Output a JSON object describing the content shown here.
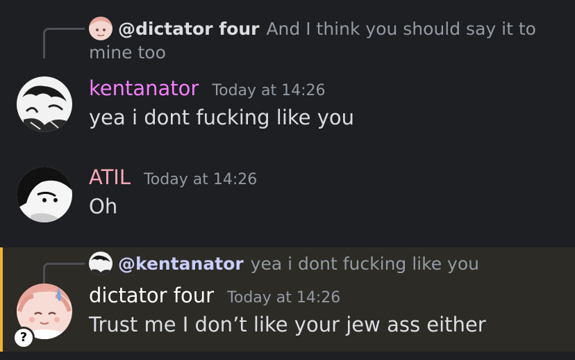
{
  "colors": {
    "background": "#1e1f22",
    "highlight_background": "#2d2b26",
    "highlight_bar": "#f0b232",
    "kentanator_name": "#f47fff",
    "atil_name": "#f8a8b8",
    "dictator_name": "#ffffff",
    "text": "#dbdee1",
    "muted": "#949ba4"
  },
  "messages": [
    {
      "reply": {
        "avatar_icon": "dictator-four-avatar-icon",
        "mention": "@dictator four",
        "text": "And I think you should say it to mine too"
      },
      "username": "kentanator",
      "avatar_icon": "kentanator-avatar-icon",
      "timestamp": "Today at 14:26",
      "content": "yea i dont fucking like you"
    },
    {
      "username": "ATIL",
      "avatar_icon": "atil-avatar-icon",
      "timestamp": "Today at 14:26",
      "content": "Oh"
    },
    {
      "reply": {
        "avatar_icon": "kentanator-avatar-icon",
        "mention": "@kentanator",
        "text": "yea i dont fucking like you"
      },
      "username": "dictator four",
      "avatar_icon": "dictator-four-avatar-icon",
      "timestamp": "Today at 14:26",
      "content": "Trust me I don’t like your jew ass either",
      "highlighted": true,
      "badge": "?"
    }
  ]
}
